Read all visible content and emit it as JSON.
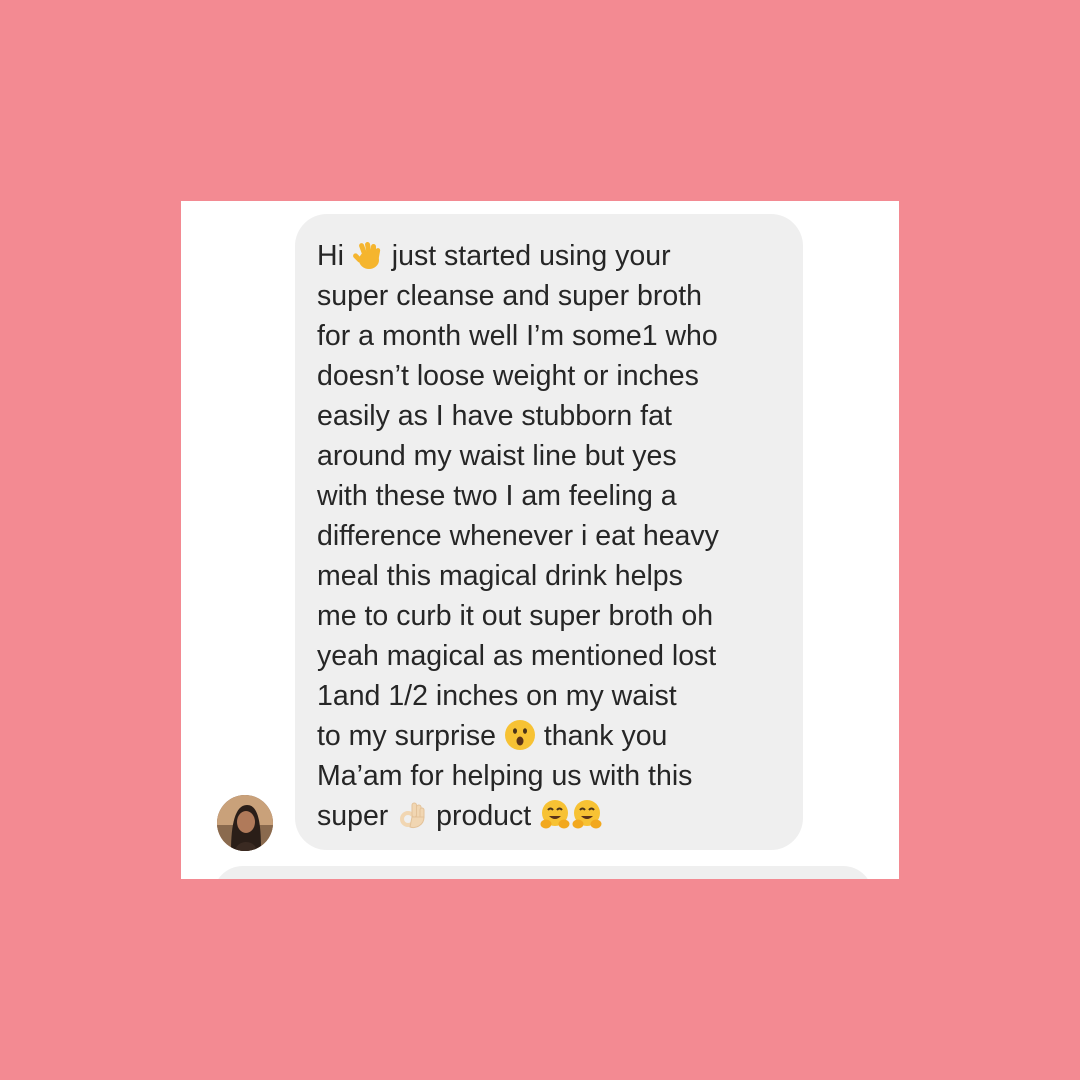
{
  "colors": {
    "background": "#f38a92",
    "card": "#ffffff",
    "bubble": "#efefef",
    "text": "#262626"
  },
  "message": {
    "lines": [
      "Hi",
      "just started using your",
      "super cleanse and super broth",
      "for a month well I’m some1 who",
      "doesn’t loose weight or inches",
      "easily as I have stubborn fat",
      "around my waist line but yes",
      "with these two I am feeling a",
      "difference whenever i eat heavy",
      "meal this magical drink helps",
      "me to curb it out super broth oh",
      "yeah magical as mentioned lost",
      "1and 1/2 inches on my waist",
      "to my surprise",
      "thank you",
      "Ma’am for helping us with this",
      "super",
      "product"
    ],
    "emojis": [
      "waving-hand-emoji",
      "surprised-face-emoji",
      "ok-hand-emoji",
      "hugging-face-emoji",
      "hugging-face-emoji"
    ]
  },
  "sender": {
    "avatar": "avatar-icon"
  }
}
